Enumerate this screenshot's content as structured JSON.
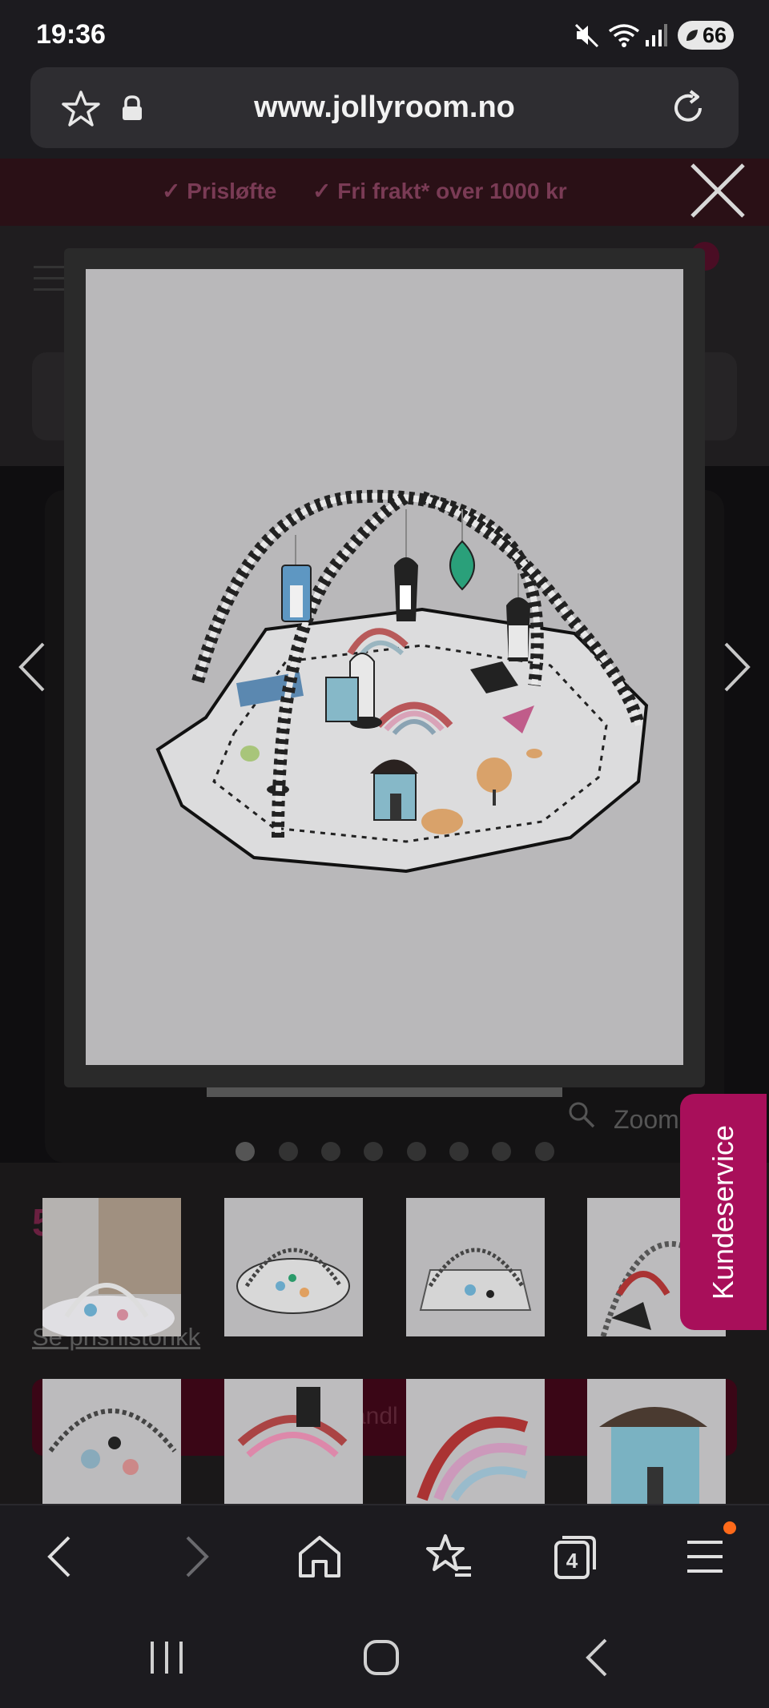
{
  "status_bar": {
    "time": "19:36",
    "battery": "66",
    "icons": [
      "mute-icon",
      "wifi-icon",
      "signal-icon",
      "battery-icon"
    ]
  },
  "browser": {
    "url": "www.jollyroom.no",
    "tabs_count": "4",
    "toolbar_icons": [
      "back-icon",
      "forward-icon",
      "home-icon",
      "bookmarks-icon",
      "tabs-icon",
      "menu-icon"
    ]
  },
  "page": {
    "promo": {
      "item1": "Prisløfte",
      "item2": "Fri frakt* over 1000 kr"
    },
    "zoom_label": "Zoom",
    "carousel": {
      "dot_count": 8,
      "active_index": 0
    },
    "price_fragment": "5",
    "price_history_link": "Se prishistorikk",
    "cart_button_fragment": "andl"
  },
  "lightbox": {
    "image_alt": "Babygym lekematte med buer og hengende leker",
    "close_icon": "close-icon",
    "prev_icon": "chevron-left-icon",
    "next_icon": "chevron-right-icon"
  },
  "kundeservice": {
    "label": "Kundeservice"
  },
  "colors": {
    "accent": "#a80f5a",
    "chrome": "#1c1b1f",
    "notification": "#ff6a1a"
  }
}
